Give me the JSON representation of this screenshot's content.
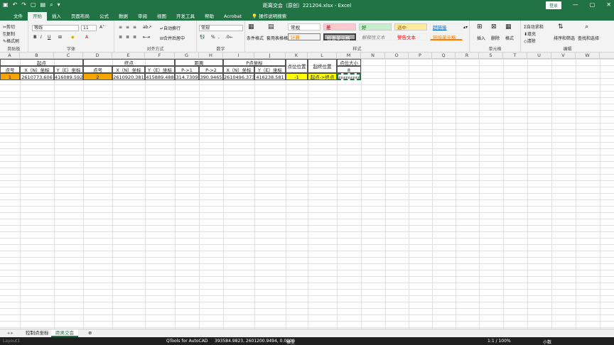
{
  "window": {
    "title": "距离交会（原创）221204.xlsx  -  Excel",
    "login": "登录"
  },
  "tabs": [
    "文件",
    "开始",
    "插入",
    "页面布局",
    "公式",
    "数据",
    "审阅",
    "视图",
    "开发工具",
    "帮助",
    "Acrobat",
    "操作说明搜索"
  ],
  "ribbon": {
    "clipboard": {
      "cut": "剪切",
      "copy": "复制",
      "painter": "格式刷",
      "label": "剪贴板"
    },
    "font": {
      "name": "等线",
      "size": "11",
      "label": "字体"
    },
    "align": {
      "wrap": "自动换行",
      "merge": "合并后居中",
      "label": "对齐方式"
    },
    "number": {
      "format": "常规",
      "pct": "%",
      "comma": ",",
      "label": "数字"
    },
    "styles": {
      "cond": "条件格式",
      "table": "套用表格格式",
      "label": "样式",
      "cells": [
        "常规",
        "差",
        "好",
        "适中",
        "超链接",
        "计算",
        "检查单元格",
        "解释性文本",
        "警告文本",
        "链接单元格"
      ]
    },
    "cellsgrp": {
      "insert": "插入",
      "delete": "删除",
      "format": "格式",
      "label": "单元格"
    },
    "edit": {
      "sum": "自动求和",
      "fill": "填充",
      "clear": "清除",
      "sort": "排序和筛选",
      "find": "查找和选择",
      "label": "编辑"
    }
  },
  "columns": [
    "A",
    "B",
    "C",
    "D",
    "E",
    "F",
    "G",
    "H",
    "I",
    "J",
    "K",
    "L",
    "M",
    "N",
    "O",
    "P",
    "Q",
    "R",
    "S",
    "T",
    "U",
    "V",
    "W"
  ],
  "sheet": {
    "h1": {
      "start": "起点",
      "end": "终点",
      "dist": "距离",
      "p": "P点坐标",
      "pos": "点位位置",
      "se": "起终位置",
      "size": "点位大小"
    },
    "h2": {
      "a": "点号",
      "b": "X（N）坐标",
      "c": "Y（E）坐标",
      "d": "点号",
      "e": "X（N）坐标",
      "f": "Y（E）坐标",
      "g": "P->1",
      "h": "P->2",
      "i": "X（N）坐标",
      "j": "Y（E）坐标",
      "m": "8"
    },
    "r3": {
      "a": "1",
      "b": "2610773.606",
      "c": "416089.592",
      "d": "2",
      "e": "2610920.381",
      "f": "415889.488",
      "g": "314.7309",
      "h": "390.9465",
      "i": "2610496.373",
      "j": "416238.581",
      "k": "-1",
      "l": "起点->终点",
      "m": "#########"
    }
  },
  "sheettabs": [
    "控制点坐标",
    "距离交会"
  ],
  "status": {
    "left": "Layout1",
    "plugin": "QTools for AutoCAD",
    "coords": "393584.9823, 2601200.9494, 0.0000",
    "model": "模型",
    "scale": "1:1 / 100%",
    "unit": "小数"
  },
  "colors": {
    "green": "#217346",
    "orange": "#f7a600",
    "yellow": "#ffff00"
  }
}
